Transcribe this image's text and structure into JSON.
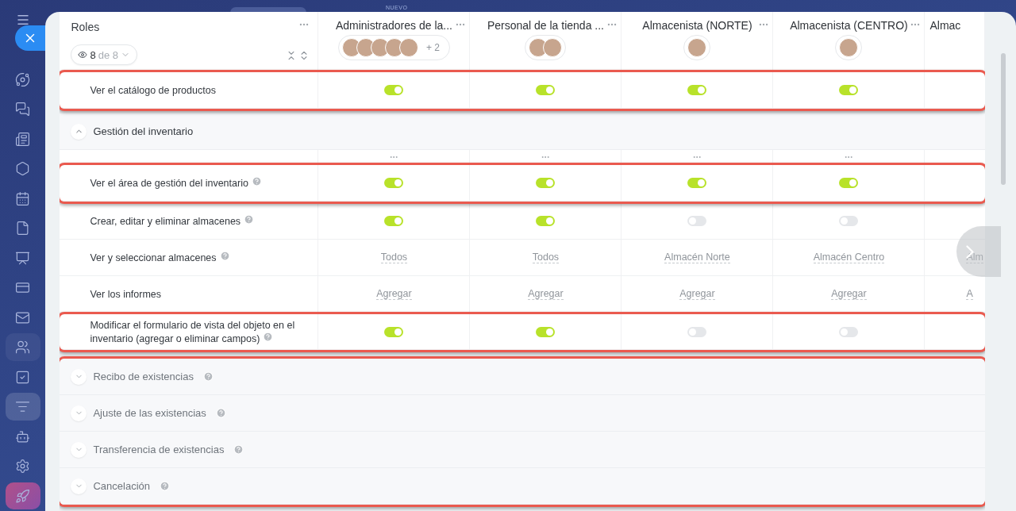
{
  "top_label": "NUEVO",
  "header": {
    "title": "Roles",
    "filter": {
      "count": "8",
      "total": "de 8"
    },
    "columns": [
      {
        "title": "Administradores de la...",
        "avatars": [
          {
            "kind": "photo"
          },
          {
            "kind": "photo"
          },
          {
            "kind": "photo"
          },
          {
            "kind": "photo"
          },
          {
            "kind": "photo"
          }
        ],
        "more": "+ 2"
      },
      {
        "title": "Personal de la tienda ...",
        "avatars": [
          {
            "kind": "photo"
          },
          {
            "kind": "photo"
          }
        ]
      },
      {
        "title": "Almacenista (NORTE)",
        "avatars": [
          {
            "kind": "photo"
          }
        ]
      },
      {
        "title": "Almacenista (CENTRO)",
        "avatars": [
          {
            "kind": "photo"
          }
        ]
      },
      {
        "title": "Almac"
      }
    ]
  },
  "sections": [
    {
      "kind": "toggle",
      "label": "Ver el catálogo de productos",
      "highlighted": true,
      "cells": [
        {
          "on": true
        },
        {
          "on": true
        },
        {
          "on": true
        },
        {
          "on": true
        }
      ]
    },
    {
      "kind": "group",
      "label": "Gestión del inventario",
      "expanded": true,
      "children": [
        {
          "kind": "menus"
        },
        {
          "kind": "toggle",
          "label": "Ver el área de gestión del inventario",
          "help": true,
          "highlighted": true,
          "cells": [
            {
              "on": true
            },
            {
              "on": true
            },
            {
              "on": true
            },
            {
              "on": true
            }
          ]
        },
        {
          "kind": "toggle",
          "label": "Crear, editar y eliminar almacenes",
          "help": true,
          "cells": [
            {
              "on": true
            },
            {
              "on": true
            },
            {
              "on": false
            },
            {
              "on": false
            }
          ]
        },
        {
          "kind": "select",
          "label": "Ver y seleccionar almacenes",
          "help": true,
          "cells": [
            "Todos",
            "Todos",
            "Almacén Norte",
            "Almacén Centro",
            "Alm"
          ]
        },
        {
          "kind": "select",
          "label": "Ver los informes",
          "cells": [
            "Agregar",
            "Agregar",
            "Agregar",
            "Agregar",
            "A"
          ]
        },
        {
          "kind": "toggle",
          "label": "Modificar el formulario de vista del objeto en el inventario (agregar o eliminar campos)",
          "help": true,
          "highlighted": true,
          "cells": [
            {
              "on": true
            },
            {
              "on": true
            },
            {
              "on": false
            },
            {
              "on": false
            }
          ]
        }
      ]
    },
    {
      "kind": "group",
      "label": "Recibo de existencias",
      "help": true,
      "expanded": false,
      "highlighted": true
    },
    {
      "kind": "group",
      "label": "Ajuste de las existencias",
      "help": true,
      "expanded": false,
      "highlighted": true
    },
    {
      "kind": "group",
      "label": "Transferencia de existencias",
      "help": true,
      "expanded": false,
      "highlighted": true
    },
    {
      "kind": "group",
      "label": "Cancelación",
      "help": true,
      "expanded": false,
      "highlighted": true
    }
  ]
}
